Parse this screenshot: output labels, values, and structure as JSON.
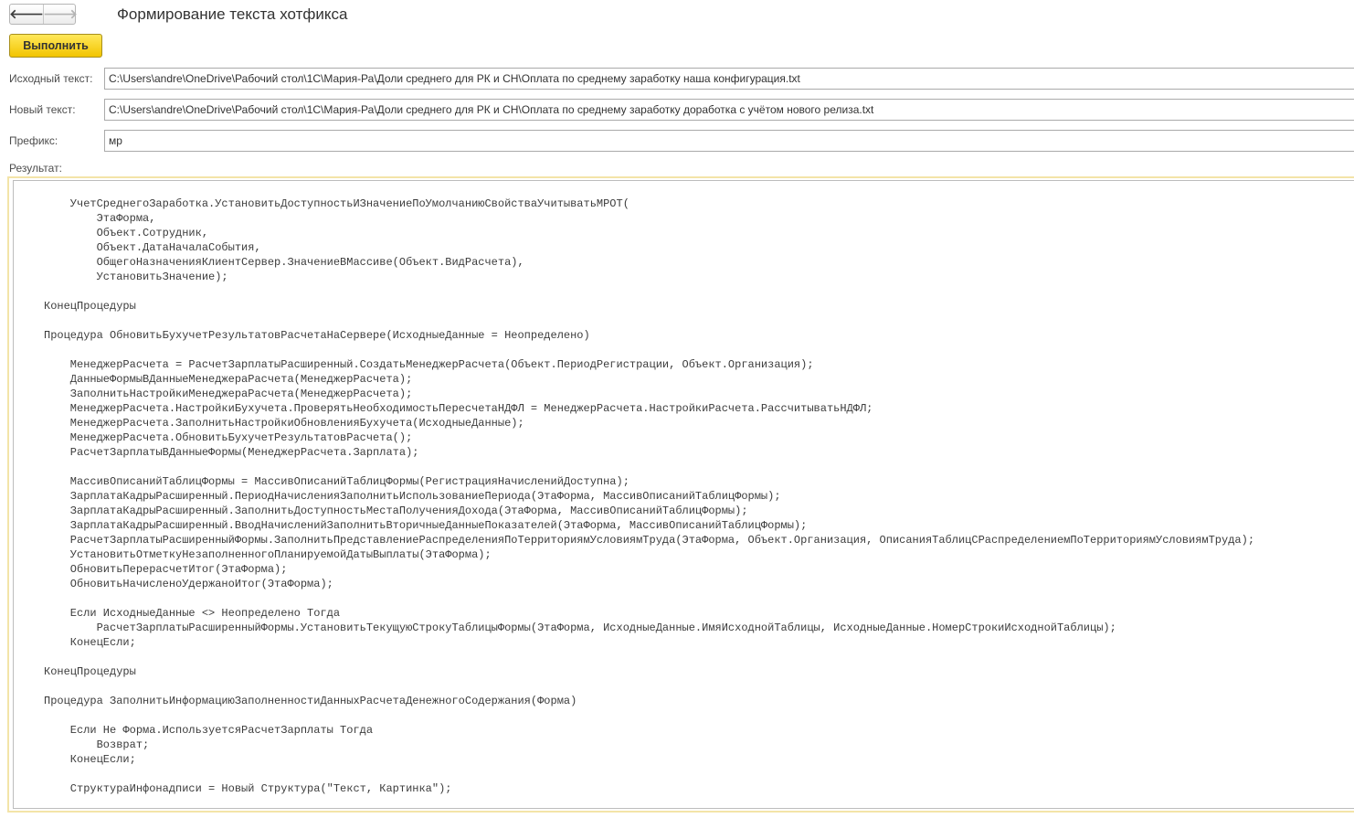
{
  "header": {
    "back_icon": "arrow-left-icon",
    "back_glyph": "🡐",
    "forward_icon": "arrow-right-icon",
    "forward_glyph": "🡒",
    "title": "Формирование текста хотфикса"
  },
  "toolbar": {
    "run_label": "Выполнить"
  },
  "form": {
    "source_label": "Исходный текст:",
    "source_value": "C:\\Users\\andre\\OneDrive\\Рабочий стол\\1С\\Мария-Ра\\Доли среднего для РК и СН\\Оплата по среднему заработку наша конфигурация.txt",
    "new_label": "Новый текст:",
    "new_value": "C:\\Users\\andre\\OneDrive\\Рабочий стол\\1С\\Мария-Ра\\Доли среднего для РК и СН\\Оплата по среднему заработку доработка с учётом нового релиза.txt",
    "prefix_label": "Префикс:",
    "prefix_value": "мр",
    "result_label": "Результат:"
  },
  "result": {
    "lines": [
      "    УчетСреднегоЗаработка.УстановитьДоступностьИЗначениеПоУмолчаниюСвойстваУчитыватьМРОТ(",
      "        ЭтаФорма,",
      "        Объект.Сотрудник,",
      "        Объект.ДатаНачалаСобытия,",
      "        ОбщегоНазначенияКлиентСервер.ЗначениеВМассиве(Объект.ВидРасчета),",
      "        УстановитьЗначение);",
      "",
      "КонецПроцедуры",
      "",
      "Процедура ОбновитьБухучетРезультатовРасчетаНаСервере(ИсходныеДанные = Неопределено)",
      "",
      "    МенеджерРасчета = РасчетЗарплатыРасширенный.СоздатьМенеджерРасчета(Объект.ПериодРегистрации, Объект.Организация);",
      "    ДанныеФормыВДанныеМенеджераРасчета(МенеджерРасчета);",
      "    ЗаполнитьНастройкиМенеджераРасчета(МенеджерРасчета);",
      "    МенеджерРасчета.НастройкиБухучета.ПроверятьНеобходимостьПересчетаНДФЛ = МенеджерРасчета.НастройкиРасчета.РассчитыватьНДФЛ;",
      "    МенеджерРасчета.ЗаполнитьНастройкиОбновленияБухучета(ИсходныеДанные);",
      "    МенеджерРасчета.ОбновитьБухучетРезультатовРасчета();",
      "    РасчетЗарплатыВДанныеФормы(МенеджерРасчета.Зарплата);",
      "",
      "    МассивОписанийТаблицФормы = МассивОписанийТаблицФормы(РегистрацияНачисленийДоступна);",
      "    ЗарплатаКадрыРасширенный.ПериодНачисленияЗаполнитьИспользованиеПериода(ЭтаФорма, МассивОписанийТаблицФормы);",
      "    ЗарплатаКадрыРасширенный.ЗаполнитьДоступностьМестаПолученияДохода(ЭтаФорма, МассивОписанийТаблицФормы);",
      "    ЗарплатаКадрыРасширенный.ВводНачисленийЗаполнитьВторичныеДанныеПоказателей(ЭтаФорма, МассивОписанийТаблицФормы);",
      "    РасчетЗарплатыРасширенныйФормы.ЗаполнитьПредставлениеРаспределенияПоТерриториямУсловиямТруда(ЭтаФорма, Объект.Организация, ОписанияТаблицСРаспределениемПоТерриториямУсловиямТруда);",
      "    УстановитьОтметкуНезаполненногоПланируемойДатыВыплаты(ЭтаФорма);",
      "    ОбновитьПерерасчетИтог(ЭтаФорма);",
      "    ОбновитьНачисленоУдержаноИтог(ЭтаФорма);",
      "",
      "    Если ИсходныеДанные <> Неопределено Тогда",
      "        РасчетЗарплатыРасширенныйФормы.УстановитьТекущуюСтрокуТаблицыФормы(ЭтаФорма, ИсходныеДанные.ИмяИсходнойТаблицы, ИсходныеДанные.НомерСтрокиИсходнойТаблицы);",
      "    КонецЕсли;",
      "",
      "КонецПроцедуры",
      "",
      "Процедура ЗаполнитьИнформациюЗаполненностиДанныхРасчетаДенежногоСодержания(Форма)",
      "",
      "    Если Не Форма.ИспользуетсяРасчетЗарплаты Тогда",
      "        Возврат;",
      "    КонецЕсли;",
      "",
      "    СтруктураИнфонадписи = Новый Структура(\"Текст, Картинка\");"
    ]
  }
}
